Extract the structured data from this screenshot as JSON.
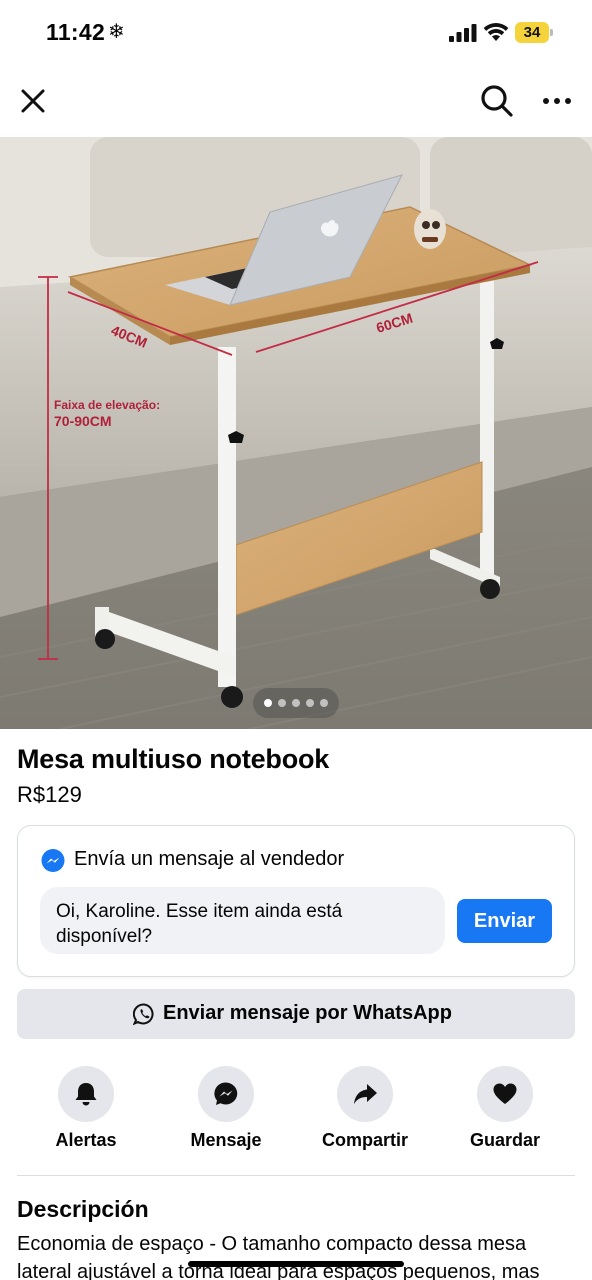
{
  "status_bar": {
    "time": "11:42",
    "weather_icon": "snowflake-icon",
    "battery": "34"
  },
  "nav": {
    "close_icon": "close-icon",
    "search_icon": "search-icon",
    "more_icon": "more-icon"
  },
  "photo": {
    "label_depth": "40CM",
    "label_width": "60CM",
    "label_height_line1": "Faixa de elevação:",
    "label_height_line2": "70-90CM",
    "pager_count": 5,
    "pager_active": 0
  },
  "listing": {
    "title": "Mesa multiuso notebook",
    "price": "R$129"
  },
  "message": {
    "header": "Envía un mensaje al vendedor",
    "text": "Oi, Karoline. Esse item ainda está disponível?",
    "send_label": "Enviar"
  },
  "whatsapp": {
    "label": "Enviar mensaje por WhatsApp"
  },
  "actions": [
    {
      "label": "Alertas",
      "icon": "bell-icon"
    },
    {
      "label": "Mensaje",
      "icon": "messenger-icon"
    },
    {
      "label": "Compartir",
      "icon": "share-icon"
    },
    {
      "label": "Guardar",
      "icon": "heart-icon"
    }
  ],
  "description": {
    "title": "Descripción",
    "text": "Economia de espaço - O tamanho compacto dessa mesa lateral ajustável a torna ideal para espaços pequenos, mas"
  },
  "colors": {
    "accent": "#1877f2",
    "battery": "#f4d43a",
    "button_gray": "#e4e6eb"
  }
}
